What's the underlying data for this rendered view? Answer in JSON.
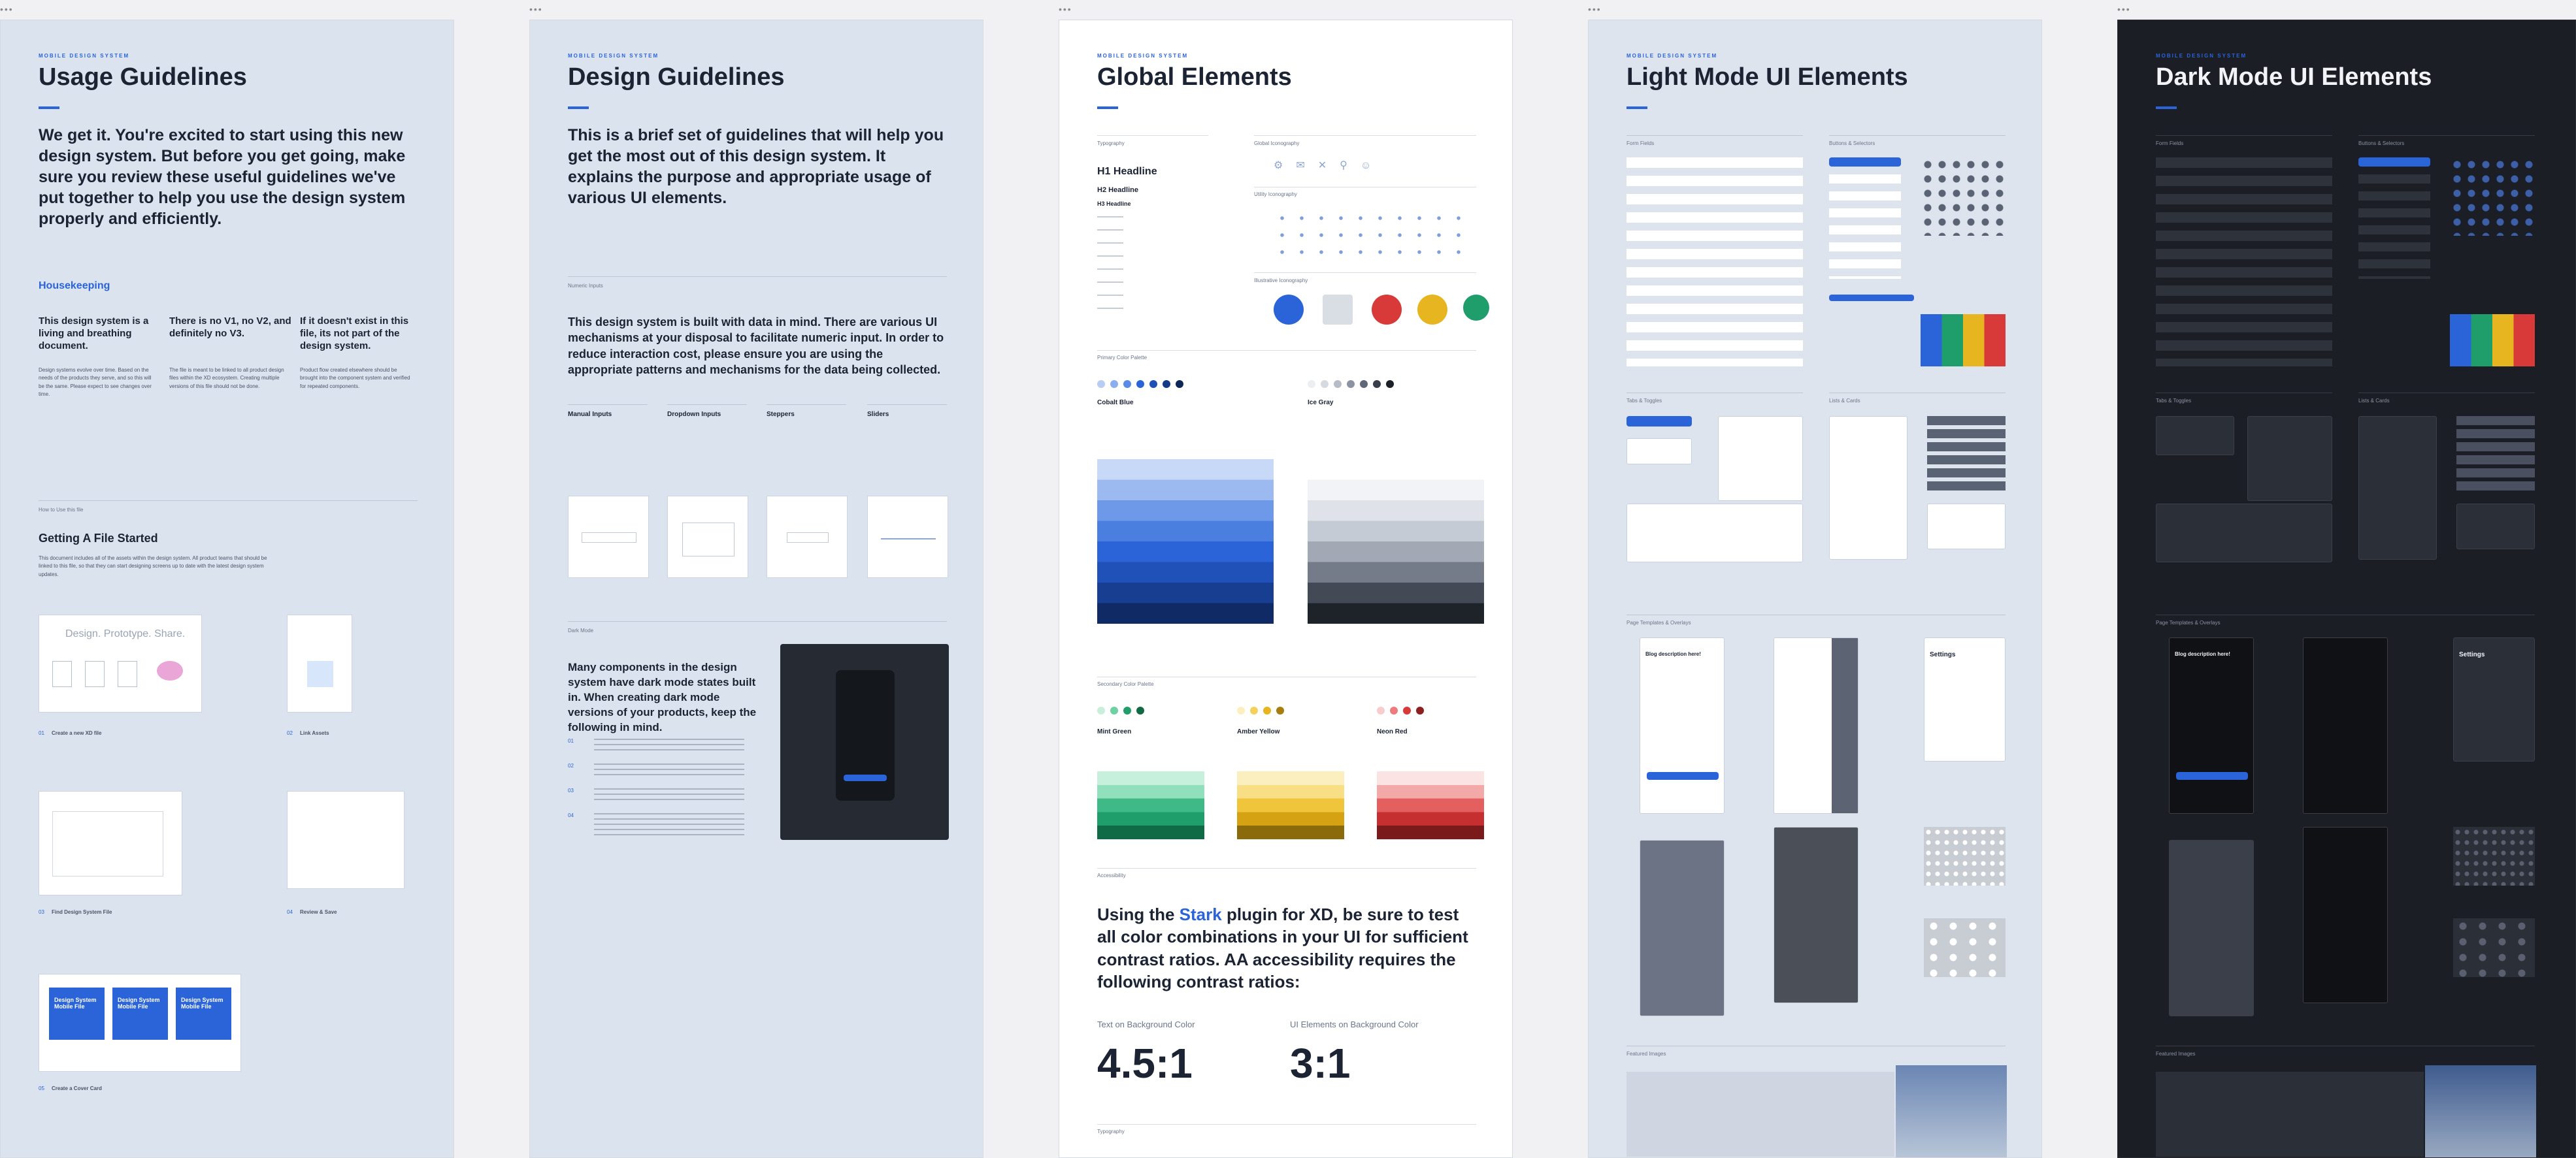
{
  "boards": [
    {
      "eyebrow": "MOBILE DESIGN SYSTEM",
      "title": "Usage Guidelines",
      "lead": "We get it. You're excited to start using this new design system. But before you get going, make sure you review these useful guidelines we've put together to help you use the design system properly and efficiently.",
      "section": "Housekeeping",
      "cols": [
        {
          "h": "This design system is a living and breathing document.",
          "t": "Design systems evolve over time. Based on the needs of the products they serve, and so this will be the same. Please expect to see changes over time."
        },
        {
          "h": "There is no V1, no V2, and definitely no V3.",
          "t": "The file is meant to be linked to all product design files within the XD ecosystem. Creating multiple versions of this file should not be done."
        },
        {
          "h": "If it doesn't exist in this file, its not part of the design system.",
          "t": "Product flow created elsewhere should be brought into the component system and verified for repeated components."
        }
      ],
      "getting_started_label": "How to Use this file",
      "getting_started": "Getting A File Started",
      "getting_started_text": "This document includes all of the assets within the design system. All product teams that should be linked to this file, so that they can start designing screens up to date with the latest design system updates.",
      "steps": [
        {
          "n": "01",
          "label": "Create a new XD file"
        },
        {
          "n": "02",
          "label": "Link Assets"
        },
        {
          "n": "03",
          "label": "Find Design System File"
        },
        {
          "n": "04",
          "label": "Review & Save"
        },
        {
          "n": "05",
          "label": "Create a Cover Card"
        }
      ],
      "preview_text": "Design. Prototype. Share.",
      "cover_label": "Design System Mobile File"
    },
    {
      "eyebrow": "MOBILE DESIGN SYSTEM",
      "title": "Design Guidelines",
      "lead": "This is a brief set of guidelines that will help you get the most out of this design system. It explains the purpose and appropriate usage of various UI elements.",
      "section1": "Numeric Inputs",
      "intro": "This design system is built with data in mind. There are various UI mechanisms at your disposal to facilitate numeric input. In order to reduce interaction cost, please ensure you are using the appropriate patterns and mechanisms for the data being collected.",
      "inputs": [
        "Manual Inputs",
        "Dropdown Inputs",
        "Steppers",
        "Sliders"
      ],
      "section2": "Dark Mode",
      "dark_text": "Many components in the design system have dark mode states built in. When creating dark mode versions of your products, keep the following in mind.",
      "dark_steps": [
        "01",
        "02",
        "03",
        "04"
      ]
    },
    {
      "eyebrow": "MOBILE DESIGN SYSTEM",
      "title": "Global Elements",
      "typography_label": "Typography",
      "h1": "H1 Headline",
      "h2": "H2 Headline",
      "h3": "H3 Headline",
      "icons_label": "Global Iconography",
      "nav_label": "Utility Iconography",
      "illus_label": "Illustrative Iconography",
      "colors_label": "Primary Color Palette",
      "color1": "Cobalt Blue",
      "color2": "Ice Gray",
      "status_label": "Secondary Color Palette",
      "mint": "Mint Green",
      "amber": "Amber Yellow",
      "neon": "Neon Red",
      "a11y_label": "Accessibility",
      "a11y_pre": "Using the ",
      "a11y_link": "Stark",
      "a11y_post": " plugin for XD, be sure to test all color combinations in your UI for sufficient contrast ratios. AA accessibility requires the following contrast ratios:",
      "r1_label": "Text on Background Color",
      "r1": "4.5:1",
      "r2_label": "UI Elements on Background Color",
      "r2": "3:1",
      "footer_label": "Typography"
    },
    {
      "eyebrow": "MOBILE DESIGN SYSTEM",
      "title": "Light Mode UI Elements",
      "s1": "Form Fields",
      "s2": "Buttons & Selectors",
      "s3": "Tabs & Toggles",
      "s4": "Lists & Cards",
      "s5": "Page Templates & Overlays",
      "s6": "Featured Images",
      "blog_title": "Blog description here!",
      "settings": "Settings"
    },
    {
      "eyebrow": "MOBILE DESIGN SYSTEM",
      "title": "Dark Mode UI Elements",
      "s1": "Form Fields",
      "s2": "Buttons & Selectors",
      "s3": "Tabs & Toggles",
      "s4": "Lists & Cards",
      "s5": "Page Templates & Overlays",
      "s6": "Featured Images",
      "blog_title": "Blog description here!",
      "settings": "Settings"
    }
  ],
  "colors": {
    "accent": "#2a64d8",
    "board_light": "#dbe3ef",
    "board_dark": "#1b1e24",
    "mint": "#1f9d6b",
    "amber": "#e7b51f",
    "neon": "#d83a3a"
  }
}
